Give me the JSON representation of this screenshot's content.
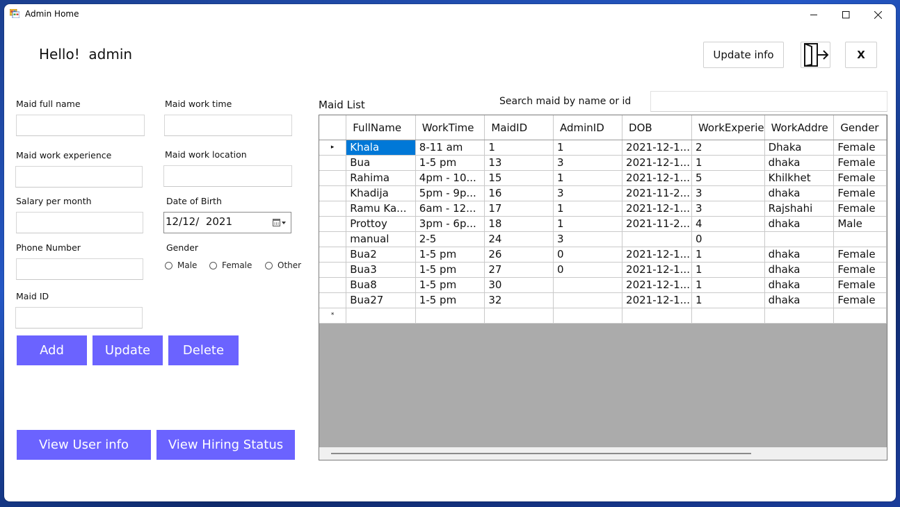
{
  "window": {
    "title": "Admin Home",
    "app_icon": "windows-forms-icon"
  },
  "header": {
    "greeting": "Hello!  admin",
    "update_info_label": "Update info",
    "logout_icon": "logout-icon",
    "close_label": "X"
  },
  "form": {
    "full_name_label": "Maid full name",
    "work_time_label": "Maid work time",
    "work_experience_label": "Maid work experience",
    "work_location_label": "Maid work location",
    "salary_label": "Salary per month",
    "dob_label": "Date of Birth",
    "dob_value": "12/12/  2021",
    "phone_label": "Phone Number",
    "gender_label": "Gender",
    "gender_options": [
      "Male",
      "Female",
      "Other"
    ],
    "maid_id_label": "Maid ID"
  },
  "actions": {
    "add": "Add",
    "update": "Update",
    "delete": "Delete",
    "view_user_info": "View User info",
    "view_hiring_status": "View Hiring Status"
  },
  "list": {
    "title": "Maid List",
    "search_label": "Search maid by name or id",
    "columns": [
      "FullName",
      "WorkTime",
      "MaidID",
      "AdminID",
      "DOB",
      "WorkExperie",
      "WorkAddre",
      "Gender"
    ],
    "rows": [
      [
        "Khala",
        "8-11 am",
        "1",
        "1",
        "2021-12-1...",
        "2",
        "Dhaka",
        "Female"
      ],
      [
        "Bua",
        "1-5 pm",
        "13",
        "3",
        "2021-12-1...",
        "1",
        "dhaka",
        "Female"
      ],
      [
        "Rahima",
        "4pm - 10...",
        "15",
        "1",
        "2021-12-1...",
        "5",
        "Khilkhet",
        "Female"
      ],
      [
        "Khadija",
        "5pm - 9p...",
        "16",
        "3",
        "2021-11-2...",
        "3",
        "dhaka",
        "Female"
      ],
      [
        "Ramu Ka...",
        "6am - 12...",
        "17",
        "1",
        "2021-12-1...",
        "3",
        "Rajshahi",
        "Female"
      ],
      [
        "Prottoy",
        "3pm - 6p...",
        "18",
        "1",
        "2021-11-2...",
        "4",
        "dhaka",
        "Male"
      ],
      [
        "manual",
        "2-5",
        "24",
        "3",
        "",
        "0",
        "",
        ""
      ],
      [
        "Bua2",
        "1-5 pm",
        "26",
        "0",
        "2021-12-1...",
        "1",
        "dhaka",
        "Female"
      ],
      [
        "Bua3",
        "1-5 pm",
        "27",
        "0",
        "2021-12-1...",
        "1",
        "dhaka",
        "Female"
      ],
      [
        "Bua8",
        "1-5 pm",
        "30",
        "",
        "2021-12-1...",
        "1",
        "dhaka",
        "Female"
      ],
      [
        "Bua27",
        "1-5 pm",
        "32",
        "",
        "2021-12-1...",
        "1",
        "dhaka",
        "Female"
      ]
    ],
    "new_row_marker": "*",
    "current_row_marker": "▸"
  },
  "colors": {
    "accent": "#6b63ff",
    "selection": "#0078d7",
    "grid_empty": "#ababab"
  }
}
